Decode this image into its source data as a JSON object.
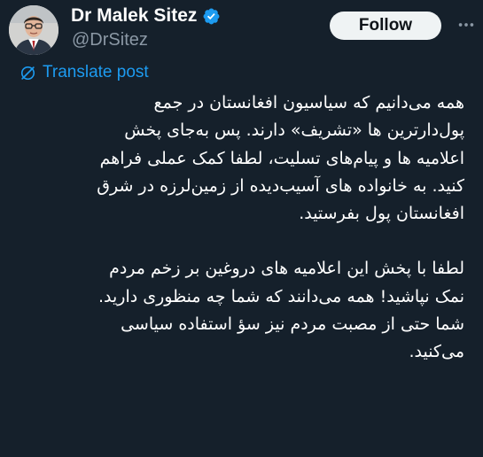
{
  "author": {
    "display_name": "Dr Malek Sitez",
    "handle": "@DrSitez",
    "verified": true,
    "avatar_icon": "avatar-photo"
  },
  "actions": {
    "follow_label": "Follow",
    "more_icon": "more-dots-icon"
  },
  "translate": {
    "label": "Translate post",
    "icon": "globe-slash-icon"
  },
  "post": {
    "paragraphs": [
      [
        "همه می‌دانیم که سیاسیون افغانستان در جمع",
        "پول‌دارترین ها «تشریف» دارند. پس به‌جای پخش",
        "اعلامیه ها و پیام‌های تسلیت، لطفا کمک عملی فراهم",
        "کنید. به خانواده های آسیب‌دیده از زمین‌لرزه در شرق",
        "افغانستان پول بفرستید."
      ],
      [
        "لطفا با پخش این اعلامیه های دروغین بر زخم مردم",
        "نمک نپاشید! همه می‌دانند که شما چه منظوری دارید.",
        "شما حتی از مصبت مردم نیز سؤ استفاده سیاسی",
        "می‌کنید."
      ]
    ]
  },
  "colors": {
    "background": "#15202b",
    "text": "#ffffff",
    "muted": "#8b98a5",
    "accent": "#1d9bf0",
    "follow_bg": "#eff3f4"
  }
}
